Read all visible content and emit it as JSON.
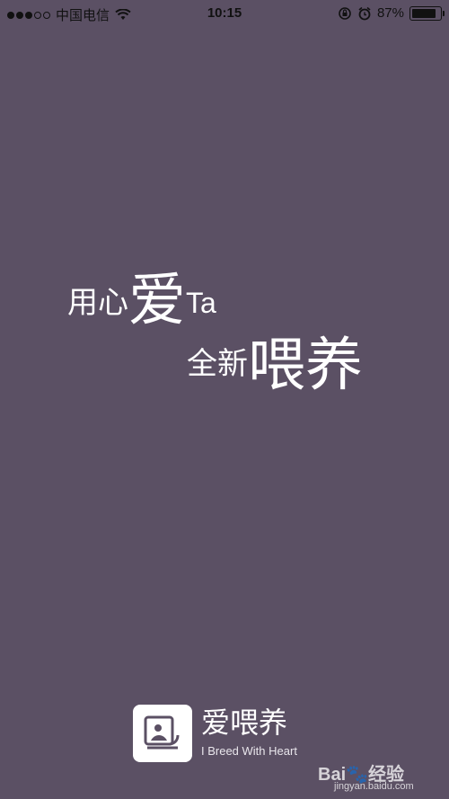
{
  "status_bar": {
    "carrier": "中国电信",
    "time": "10:15",
    "battery_percent": "87%",
    "battery_level": 0.87,
    "signal_bars_filled": 3,
    "signal_bars_total": 5,
    "icons": [
      "signal-dots-icon",
      "wifi-icon",
      "rotation-lock-icon",
      "alarm-icon",
      "battery-icon"
    ]
  },
  "hero": {
    "line1_a": "用心",
    "line1_big": "爱",
    "line1_latin": "Ta",
    "line2_a": "全新",
    "line2_big": "喂养"
  },
  "brand": {
    "name": "爱喂养",
    "tagline": "I Breed With Heart",
    "logo_icon": "pet-logo-icon"
  },
  "watermark": {
    "brand": "Bai",
    "paw": "🐾",
    "label": "经验",
    "url": "jingyan.baidu.com"
  },
  "colors": {
    "background": "#5b5064",
    "text": "#ffffff"
  }
}
